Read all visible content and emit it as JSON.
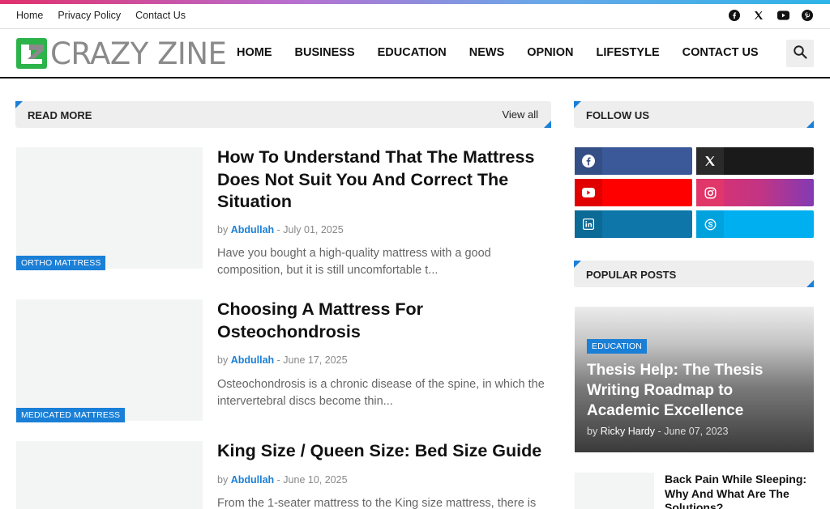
{
  "colors": {
    "accent": "#1a7fd6",
    "facebook": "#3b5998",
    "x": "#1a1a1a",
    "youtube": "#ff0000",
    "linkedin": "#0e76a8",
    "skype": "#00aff0"
  },
  "topbar": {
    "links": [
      "Home",
      "Privacy Policy",
      "Contact Us"
    ],
    "social_icons": [
      "facebook-icon",
      "x-icon",
      "youtube-icon",
      "pinterest-icon"
    ]
  },
  "logo": {
    "text": "CRAZY ZINE"
  },
  "nav": {
    "items": [
      "HOME",
      "BUSINESS",
      "EDUCATION",
      "NEWS",
      "OPNION",
      "LIFESTYLE",
      "CONTACT US"
    ],
    "search_icon": "search-icon"
  },
  "main": {
    "section_title": "READ MORE",
    "view_all": "View all",
    "posts": [
      {
        "category": "ORTHO MATTRESS",
        "title": "How To Understand That The Mattress Does Not Suit You And Correct The Situation",
        "by": "by",
        "author": "Abdullah",
        "sep": "-",
        "date": "July 01, 2025",
        "excerpt": "Have you bought a high-quality mattress with a good composition, but it is still uncomfortable t..."
      },
      {
        "category": "MEDICATED MATTRESS",
        "title": "Choosing A Mattress For Osteochondrosis",
        "by": "by",
        "author": "Abdullah",
        "sep": "-",
        "date": "June 17, 2025",
        "excerpt": "Osteochondrosis is a chronic disease of the spine, in which the intervertebral discs become thin..."
      },
      {
        "category": "",
        "title": "King Size / Queen Size: Bed Size Guide",
        "by": "by",
        "author": "Abdullah",
        "sep": "-",
        "date": "June 10, 2025",
        "excerpt": "From the 1-seater mattress to the King size mattress, there is"
      }
    ]
  },
  "sidebar": {
    "follow_title": "FOLLOW US",
    "social": [
      "facebook",
      "x",
      "youtube",
      "instagram",
      "linkedin",
      "skype"
    ],
    "popular_title": "POPULAR POSTS",
    "featured": {
      "category": "EDUCATION",
      "title": "Thesis Help: The Thesis Writing Roadmap to Academic Excellence",
      "by": "by",
      "author": "Ricky Hardy",
      "sep": "-",
      "date": "June 07, 2023"
    },
    "small_post": {
      "title": "Back Pain While Sleeping: Why And What Are The Solutions?"
    }
  }
}
